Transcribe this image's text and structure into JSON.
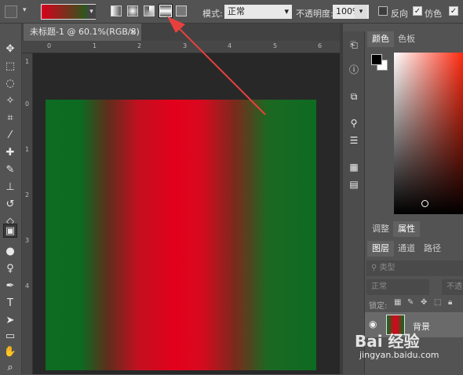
{
  "options_bar": {
    "mode_label": "模式:",
    "mode_value": "正常",
    "opacity_label": "不透明度:",
    "opacity_value": "100%",
    "reverse_label": "反向",
    "dither_label": "仿色",
    "gradient_colors": [
      "#d8001c",
      "#0a6a1d"
    ]
  },
  "document": {
    "tab_title": "未标题-1 @ 60.1%(RGB/8) *",
    "close_glyph": "×",
    "gradient_stops": [
      "#0d6b22",
      "#e3001b",
      "#0d6b22"
    ]
  },
  "rulers": {
    "top": [
      "0",
      "1",
      "2",
      "3",
      "4",
      "5",
      "6"
    ],
    "left": [
      "1",
      "0",
      "1",
      "2",
      "3",
      "4"
    ]
  },
  "panels": {
    "color_tabs": [
      "颜色",
      "色板"
    ],
    "adjust_tabs": [
      "调整",
      "属性"
    ],
    "layer_tabs": [
      "图层",
      "通道",
      "路径"
    ],
    "filter_placeholder": "类型",
    "blend_mode": "正常",
    "opacity_partial": "不透",
    "lock_label": "锁定:",
    "layer_name": "背景"
  },
  "watermark": {
    "text": "Bai 经验",
    "url": "jingyan.baidu.com"
  },
  "colors": {
    "arrow": "#e8413d",
    "foreground": "#000000",
    "background": "#ffffff"
  }
}
